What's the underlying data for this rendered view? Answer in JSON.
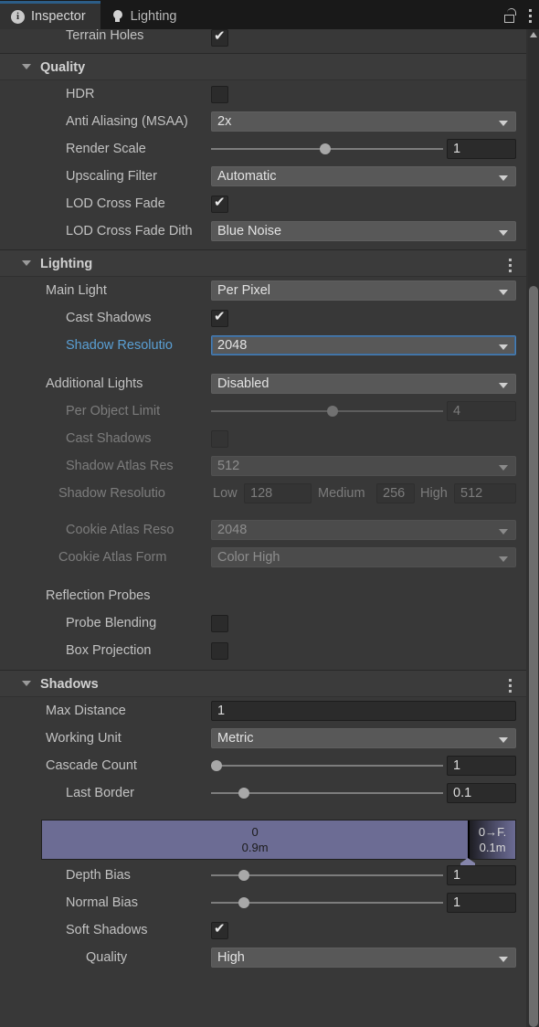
{
  "window": {
    "tabs": [
      {
        "label": "Inspector",
        "icon": "info-icon",
        "active": true
      },
      {
        "label": "Lighting",
        "icon": "lightbulb-icon",
        "active": false
      }
    ],
    "lock_icon": "lock-open-icon",
    "menu_icon": "kebab-menu-icon"
  },
  "top_partial_row": {
    "label": "Terrain Holes",
    "checked": true
  },
  "sections": {
    "quality": {
      "title": "Quality",
      "rows": {
        "hdr": {
          "label": "HDR",
          "checked": false
        },
        "anti_aliasing": {
          "label": "Anti Aliasing (MSAA)",
          "value": "2x"
        },
        "render_scale": {
          "label": "Render Scale",
          "value": "1",
          "knob_pct": 47
        },
        "upscaling_filter": {
          "label": "Upscaling Filter",
          "value": "Automatic"
        },
        "lod_cross_fade": {
          "label": "LOD Cross Fade",
          "checked": true
        },
        "lod_dithering": {
          "label": "LOD Cross Fade Dith",
          "value": "Blue Noise"
        }
      }
    },
    "lighting": {
      "title": "Lighting",
      "rows": {
        "main_light": {
          "label": "Main Light",
          "value": "Per Pixel"
        },
        "main_cast_shadows": {
          "label": "Cast Shadows",
          "checked": true
        },
        "main_shadow_resolution": {
          "label": "Shadow Resolutio",
          "value": "2048"
        },
        "additional_lights": {
          "label": "Additional Lights",
          "value": "Disabled"
        },
        "per_object_limit": {
          "label": "Per Object Limit",
          "value": "4",
          "knob_pct": 50
        },
        "add_cast_shadows": {
          "label": "Cast Shadows",
          "checked": false
        },
        "shadow_atlas_res": {
          "label": "Shadow Atlas Res",
          "value": "512"
        },
        "shadow_res_tiers": {
          "label": "Shadow Resolutio",
          "tiers": [
            {
              "name": "Low",
              "value": "128"
            },
            {
              "name": "Medium",
              "value": "256"
            },
            {
              "name": "High",
              "value": "512"
            }
          ]
        },
        "cookie_atlas_res": {
          "label": "Cookie Atlas Reso",
          "value": "2048"
        },
        "cookie_atlas_format": {
          "label": "Cookie Atlas Form",
          "value": "Color High"
        },
        "reflection_probes_header": {
          "label": "Reflection Probes"
        },
        "probe_blending": {
          "label": "Probe Blending",
          "checked": false
        },
        "box_projection": {
          "label": "Box Projection",
          "checked": false
        }
      }
    },
    "shadows": {
      "title": "Shadows",
      "rows": {
        "max_distance": {
          "label": "Max Distance",
          "value": "1"
        },
        "working_unit": {
          "label": "Working Unit",
          "value": "Metric"
        },
        "cascade_count": {
          "label": "Cascade Count",
          "value": "1",
          "knob_pct": 0
        },
        "last_border": {
          "label": "Last Border",
          "value": "0.1",
          "knob_pct": 12
        },
        "depth_bias": {
          "label": "Depth Bias",
          "value": "1",
          "knob_pct": 12
        },
        "normal_bias": {
          "label": "Normal Bias",
          "value": "1",
          "knob_pct": 12
        },
        "soft_shadows": {
          "label": "Soft Shadows",
          "checked": true
        },
        "soft_shadows_quality": {
          "label": "Quality",
          "value": "High"
        }
      },
      "cascade_bar": {
        "main": {
          "index": "0",
          "distance": "0.9m",
          "width_pct": 90
        },
        "fade": {
          "index": "0→F.",
          "distance": "0.1m",
          "width_pct": 10
        }
      }
    }
  },
  "colors": {
    "accent_blue": "#5a9fd4",
    "tab_accent": "#2c5d87",
    "cascade_purple": "#6c6c94",
    "panel_bg": "#383838",
    "header_bg": "#3b3b3b"
  }
}
